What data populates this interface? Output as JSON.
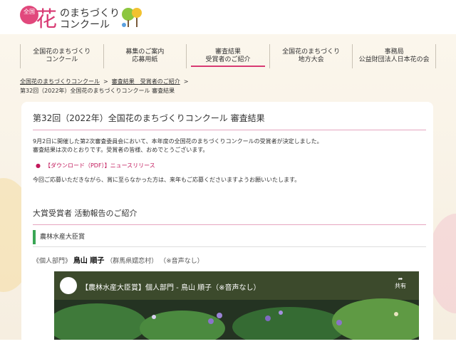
{
  "logo": {
    "circle_text": "全国",
    "big_char": "花",
    "line1": "のまちづくり",
    "line2": "コンクール"
  },
  "nav": [
    {
      "l1": "全国花のまちづくり",
      "l2": "コンクール"
    },
    {
      "l1": "募集のご案内",
      "l2": "応募用紙"
    },
    {
      "l1": "審査結果",
      "l2": "受賞者のご紹介"
    },
    {
      "l1": "全国花のまちづくり",
      "l2": "地方大会"
    },
    {
      "l1": "事務局",
      "l2": "公益財団法人日本花の会"
    }
  ],
  "breadcrumb": {
    "home": "全国花のまちづくりコンクール",
    "sep": ">",
    "section": "審査結果　受賞者のご紹介",
    "current": "第32回（2022年）全国花のまちづくりコンクール 審査結果"
  },
  "main": {
    "title": "第32回（2022年）全国花のまちづくりコンクール 審査結果",
    "intro1": "9月2日に開催した第2次審査委員会において、本年度の全国花のまちづくりコンクールの受賞者が決定しました。",
    "intro2": "審査結果は次のとおりです。受賞者の皆様、おめでとうございます。",
    "download": "【ダウンロード（PDF）】ニュースリリース",
    "sorry": "今回ご応募いただきながら、賞に至らなかった方は、来年もご応募くださいますようお願いいたします。",
    "section_title": "大賞受賞者 活動報告のご紹介",
    "award": "農林水産大臣賞",
    "winner_category": "《個人部門》",
    "winner_name": "鳥山 順子",
    "winner_place": "（群馬県嬬恋村）",
    "winner_note": "（※音声なし）",
    "video_title": "【農林水産大臣賞】個人部門 - 鳥山 順子（※音声なし）",
    "video_share": "共有"
  },
  "colors": {
    "accent": "#d83a73",
    "award_bar": "#3aa655",
    "link": "#c2185b"
  }
}
